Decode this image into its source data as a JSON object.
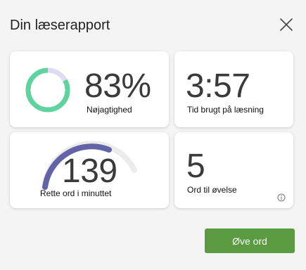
{
  "header": {
    "title": "Din læserapport",
    "close_icon": "close-icon"
  },
  "accuracy": {
    "value": "83%",
    "label": "Nøjagtighed",
    "percent": 83,
    "ring_color": "#5dd39e",
    "track_color": "#dedcf2"
  },
  "time": {
    "value": "3:57",
    "label": "Tid brugt på læsning"
  },
  "wcpm": {
    "value": "139",
    "label": "Rette ord i minuttet",
    "arc_color": "#6264a7",
    "track_color": "#ebebeb"
  },
  "practice": {
    "value": "5",
    "label": "Ord til øvelse",
    "info_icon": "info-icon"
  },
  "actions": {
    "practice_button": "Øve ord",
    "button_color": "#5a9a40"
  }
}
